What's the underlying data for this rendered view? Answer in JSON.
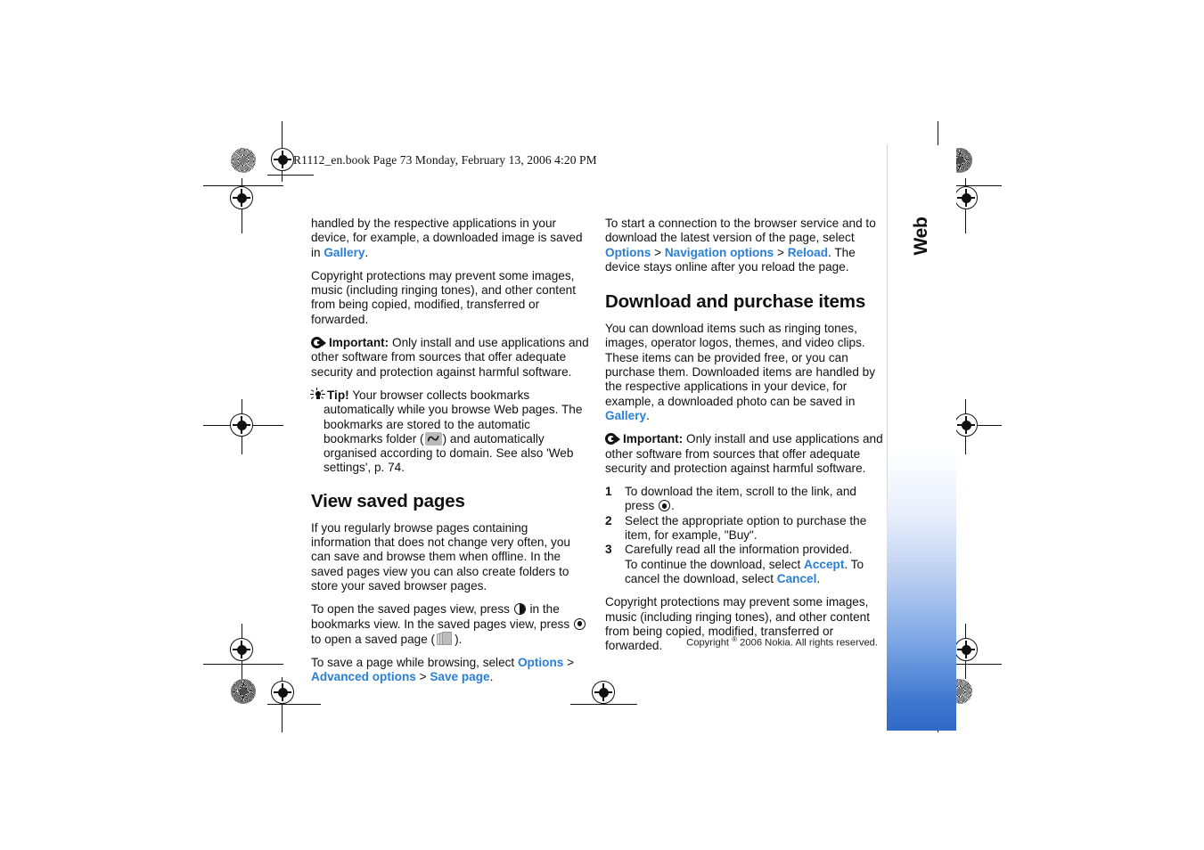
{
  "print_slug": "R1112_en.book  Page 73  Monday, February 13, 2006  4:20 PM",
  "chapter_tab": {
    "label": "Web",
    "page_number": "73",
    "accent_color": "#2f6ac7"
  },
  "footer": {
    "copyright_pre": "Copyright ",
    "copyright_symbol": "®",
    "copyright_post": " 2006 Nokia. All rights reserved."
  },
  "link_color": "#2a7fd4",
  "left_column": {
    "paragraph_1": "handled by the respective applications in your device, for example, a downloaded image is saved in ",
    "paragraph_1_link": "Gallery",
    "paragraph_1_end": ".",
    "paragraph_2": "Copyright protections may prevent some images, music (including ringing tones), and other content from being copied, modified, transferred or forwarded.",
    "important_label": "Important:",
    "important_text": " Only install and use applications and other software from sources that offer adequate security and protection against harmful software.",
    "tip_label": "Tip!",
    "tip_text_1": " Your browser collects bookmarks automatically while you browse Web pages. The bookmarks are stored to the automatic bookmarks folder (",
    "tip_text_2": ") and automatically organised according to domain. See also 'Web settings', p. 74.",
    "section_title": "View saved pages",
    "paragraph_3": "If you regularly browse pages containing information that does not change very often, you can save and browse them when offline. In the saved pages view you can also create folders to store your saved browser pages.",
    "paragraph_4_a": "To open the saved pages view, press ",
    "paragraph_4_b": " in the bookmarks view. In the saved pages view, press ",
    "paragraph_4_c": " to open a saved page (",
    "paragraph_4_d": ").",
    "paragraph_5_a": "To save a page while browsing, select ",
    "paragraph_5_link_1": "Options",
    "paragraph_5_sep_1": " > ",
    "paragraph_5_link_2": "Advanced options",
    "paragraph_5_sep_2": " > ",
    "paragraph_5_link_3": "Save page",
    "paragraph_5_end": "."
  },
  "right_column": {
    "paragraph_1_a": "To start a connection to the browser service and to download the latest version of the page, select ",
    "paragraph_1_link_1": "Options",
    "paragraph_1_sep_1": " > ",
    "paragraph_1_link_2": "Navigation options",
    "paragraph_1_sep_2": " > ",
    "paragraph_1_link_3": "Reload",
    "paragraph_1_end": ". The device stays online after you reload the page.",
    "section_title": "Download and purchase items",
    "paragraph_2_a": "You can download items such as ringing tones, images, operator logos, themes, and video clips. These items can be provided free, or you can purchase them. Downloaded items are handled by the respective applications in your device, for example, a downloaded photo can be saved in ",
    "paragraph_2_link": "Gallery",
    "paragraph_2_end": ".",
    "important_label": "Important:",
    "important_text": " Only install and use applications and other software from sources that offer adequate security and protection against harmful software.",
    "steps": [
      {
        "number": "1",
        "text_a": "To download the item, scroll to the link, and press ",
        "text_b": "."
      },
      {
        "number": "2",
        "text_a": "Select the appropriate option to purchase the item, for example, \"Buy\".",
        "text_b": ""
      },
      {
        "number": "3",
        "text_a": "Carefully read all the information provided.",
        "text_b": ""
      }
    ],
    "step_3_extra_a": "To continue the download, select ",
    "step_3_link_1": "Accept",
    "step_3_extra_b": ". To cancel the download, select ",
    "step_3_link_2": "Cancel",
    "step_3_extra_c": ".",
    "paragraph_3": "Copyright protections may prevent some images, music (including ringing tones), and other content from being copied, modified, transferred or forwarded."
  }
}
